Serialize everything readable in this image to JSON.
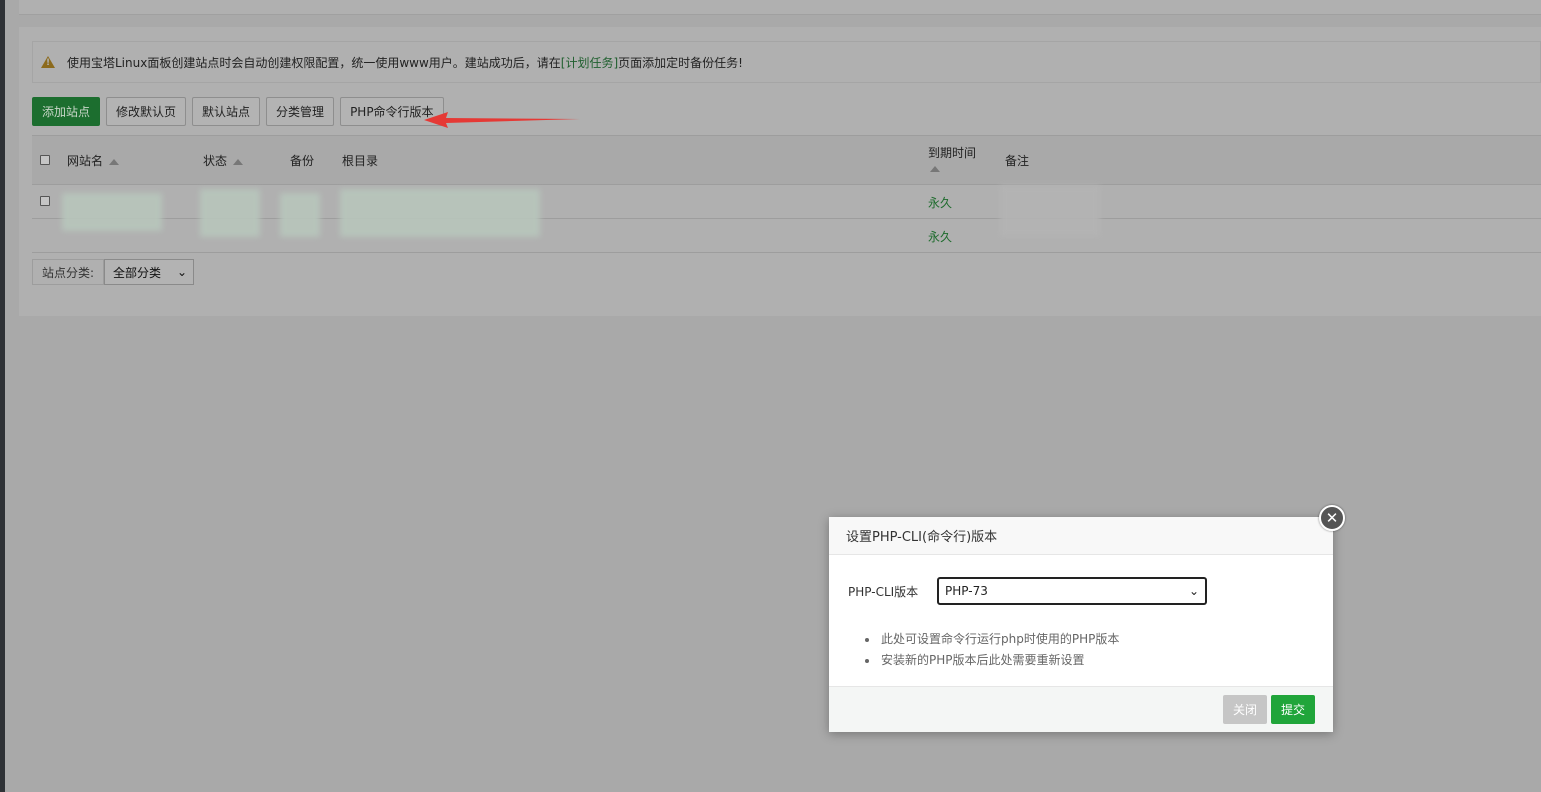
{
  "alert": {
    "text_before": "使用宝塔Linux面板创建站点时会自动创建权限配置，统一使用www用户。建站成功后，请在",
    "link": "[计划任务]",
    "text_after": "页面添加定时备份任务!"
  },
  "toolbar": {
    "add_site": "添加站点",
    "edit_default_page": "修改默认页",
    "default_site": "默认站点",
    "category_manage": "分类管理",
    "php_cli_version": "PHP命令行版本"
  },
  "table": {
    "headers": {
      "site_name": "网站名",
      "status": "状态",
      "backup": "备份",
      "root_dir": "根目录",
      "expire": "到期时间",
      "remark": "备注"
    },
    "rows": [
      {
        "expire": "永久"
      },
      {
        "expire": "永久"
      }
    ]
  },
  "filter": {
    "label": "站点分类:",
    "selected": "全部分类"
  },
  "modal": {
    "title": "设置PHP-CLI(命令行)版本",
    "field_label": "PHP-CLI版本",
    "field_value": "PHP-73",
    "tips": [
      "此处可设置命令行运行php时使用的PHP版本",
      "安装新的PHP版本后此处需要重新设置"
    ],
    "close_label": "关闭",
    "submit_label": "提交"
  },
  "colors": {
    "accent_green": "#20a53a",
    "annotation_arrow": "#e53935"
  }
}
